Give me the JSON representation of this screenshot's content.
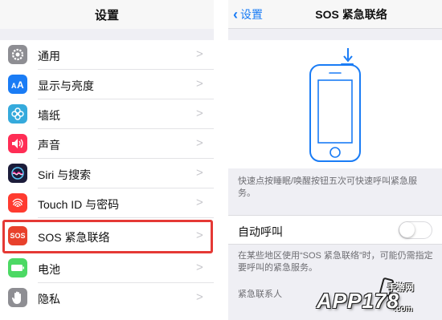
{
  "left": {
    "title": "设置",
    "items": [
      {
        "label": "通用",
        "icon": "gear-icon",
        "color": "#8e8e93"
      },
      {
        "label": "显示与亮度",
        "icon": "text-size-icon",
        "color": "#1a7cf5"
      },
      {
        "label": "墙纸",
        "icon": "flower-icon",
        "color": "#35aadc"
      },
      {
        "label": "声音",
        "icon": "speaker-icon",
        "color": "#ff2d55"
      },
      {
        "label": "Siri 与搜索",
        "icon": "siri-icon",
        "color": "#1c1c3a"
      },
      {
        "label": "Touch ID 与密码",
        "icon": "fingerprint-icon",
        "color": "#ff3b30"
      },
      {
        "label": "SOS 紧急联络",
        "icon": "sos-icon",
        "color": "#e8412c",
        "icon_text": "SOS"
      },
      {
        "label": "电池",
        "icon": "battery-icon",
        "color": "#4cd964"
      },
      {
        "label": "隐私",
        "icon": "hand-icon",
        "color": "#8e8e93"
      }
    ],
    "highlighted_item": "SOS 紧急联络",
    "highlight_color": "#e53935"
  },
  "right": {
    "back_label": "设置",
    "title": "SOS 紧急联络",
    "illustration_desc": "快速点按睡眠/唤醒按钮五次可快速呼叫紧急服务。",
    "auto_call_label": "自动呼叫",
    "auto_call_on": false,
    "auto_call_desc": "在某些地区使用“SOS 紧急联络”时，可能仍需指定要呼叫的紧急服务。",
    "contacts_label": "紧急联系人",
    "accent_color": "#1a7cf5"
  },
  "watermark": {
    "brand": "APP178",
    "sub": "手游网",
    "url": ".com"
  }
}
